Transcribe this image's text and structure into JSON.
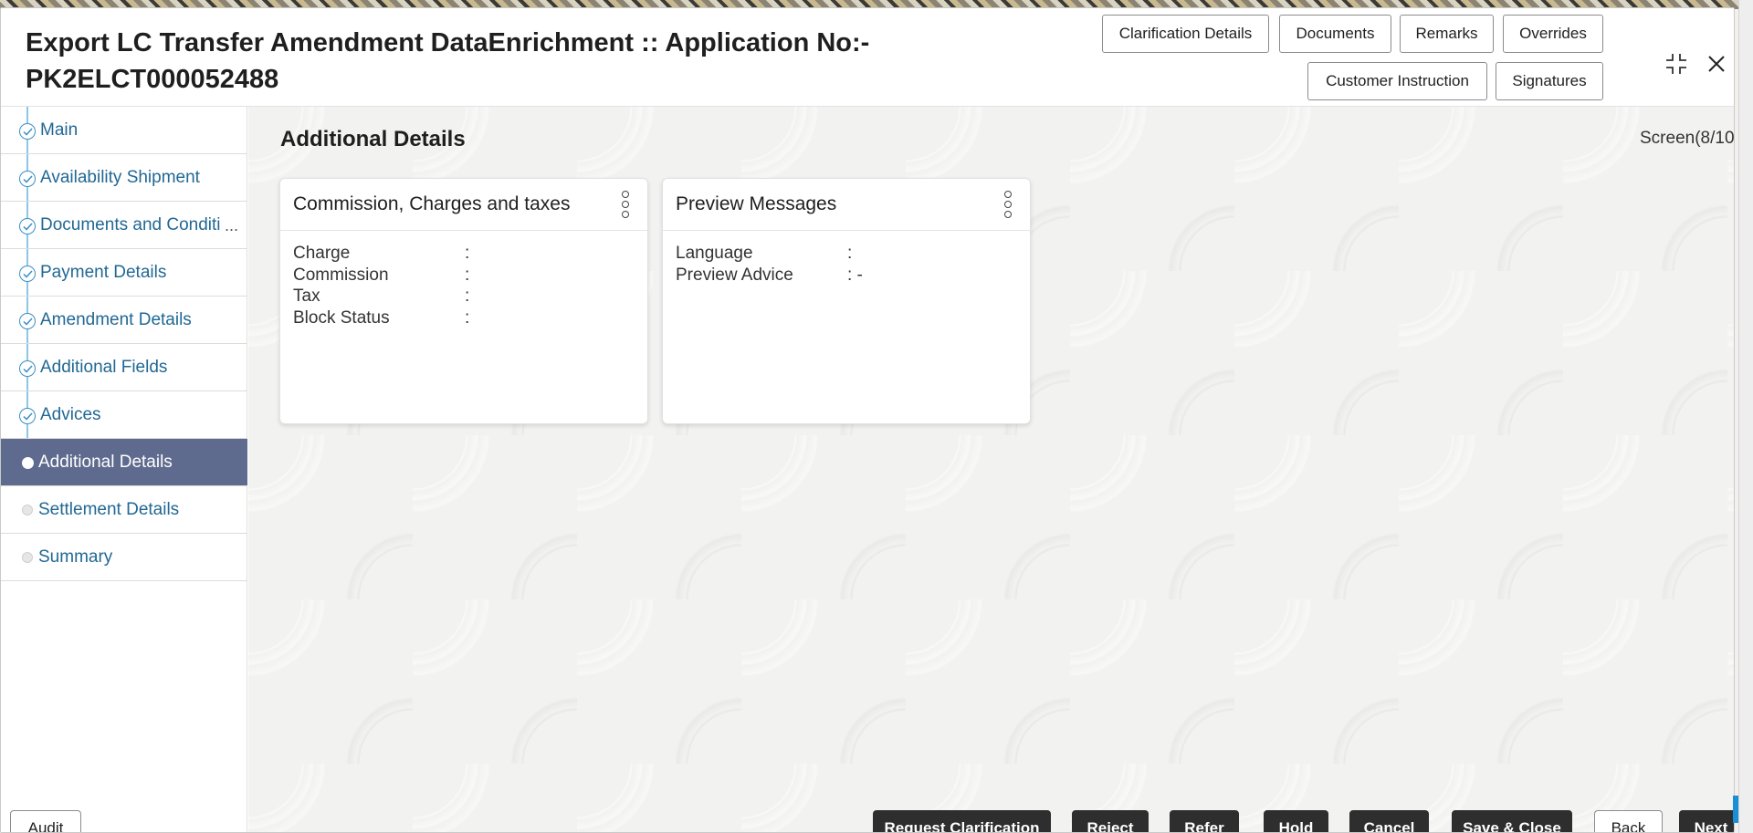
{
  "header": {
    "title": "Export LC Transfer Amendment DataEnrichment :: Application No:- PK2ELCT000052488",
    "buttons": {
      "clarification_details": "Clarification Details",
      "documents": "Documents",
      "remarks": "Remarks",
      "overrides": "Overrides",
      "customer_instruction": "Customer Instruction",
      "signatures": "Signatures"
    },
    "icons": {
      "minimize": "minimize-icon",
      "close": "close-icon"
    }
  },
  "sidebar": {
    "items": [
      {
        "label": "Main",
        "status": "done"
      },
      {
        "label": "Availability Shipment",
        "status": "done"
      },
      {
        "label": "Documents and Conditi",
        "status": "done",
        "truncated_marker": "..."
      },
      {
        "label": "Payment Details",
        "status": "done"
      },
      {
        "label": "Amendment Details",
        "status": "done"
      },
      {
        "label": "Additional Fields",
        "status": "done"
      },
      {
        "label": "Advices",
        "status": "done"
      },
      {
        "label": "Additional Details",
        "status": "active"
      },
      {
        "label": "Settlement Details",
        "status": "pending"
      },
      {
        "label": "Summary",
        "status": "pending"
      }
    ]
  },
  "main": {
    "section_title": "Additional Details",
    "screen_count": "Screen(8/10)",
    "cards": [
      {
        "title": "Commission, Charges and taxes",
        "rows": [
          {
            "key": "Charge",
            "sep": ":"
          },
          {
            "key": "Commission",
            "sep": ":"
          },
          {
            "key": "Tax",
            "sep": ":"
          },
          {
            "key": "Block Status",
            "sep": ":"
          }
        ]
      },
      {
        "title": "Preview Messages",
        "rows": [
          {
            "key": "Language",
            "sep": ":"
          },
          {
            "key": "Preview Advice",
            "sep": ": -"
          }
        ]
      }
    ]
  },
  "footer": {
    "audit": "Audit",
    "request_clarification": "Request Clarification",
    "reject": "Reject",
    "refer": "Refer",
    "hold": "Hold",
    "cancel": "Cancel",
    "save_close": "Save & Close",
    "back": "Back",
    "next": "Next"
  },
  "colors": {
    "nav_link": "#216894",
    "nav_active_bg": "#5f6b8e",
    "dark_button": "#2e2e2e",
    "step_check": "#3b8fc7"
  }
}
